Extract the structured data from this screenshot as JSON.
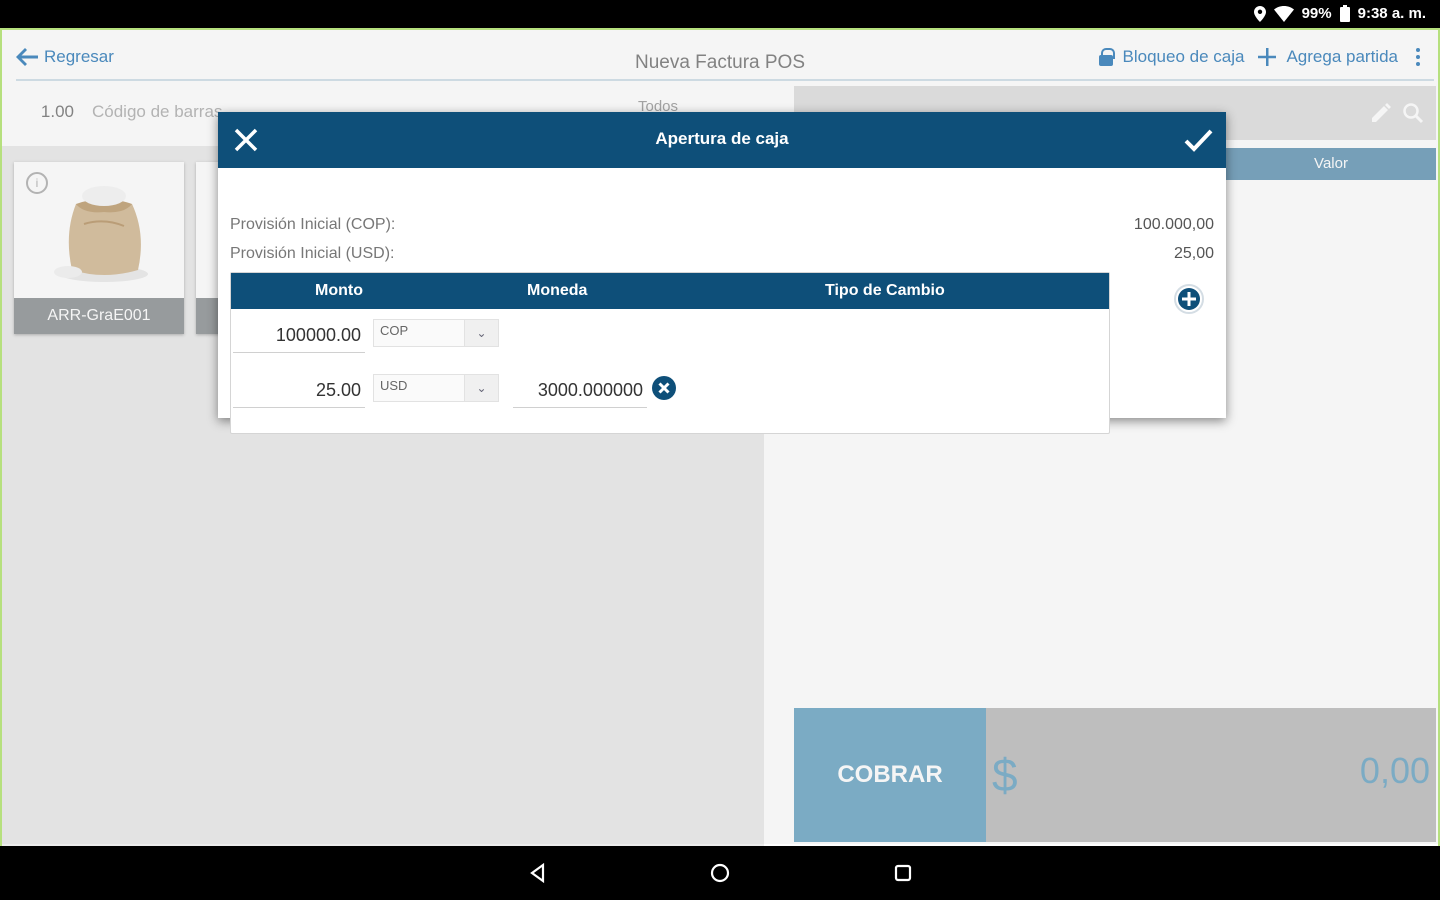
{
  "status_bar": {
    "battery": "99%",
    "time": "9:38 a. m."
  },
  "topbar": {
    "back_label": "Regresar",
    "title": "Nueva Factura POS",
    "lock_label": "Bloqueo de caja",
    "add_label": "Agrega partida"
  },
  "left": {
    "quantity": "1.00",
    "barcode_placeholder": "Código de barras",
    "filter_label": "Todos",
    "products": [
      {
        "code": "ARR-GraE001"
      }
    ]
  },
  "right": {
    "column_value": "Valor",
    "charge_label": "COBRAR",
    "currency_symbol": "$",
    "total": "0,00"
  },
  "dialog": {
    "title": "Apertura de caja",
    "provisions": [
      {
        "label": "Provisión Inicial (COP):",
        "value": "100.000,00"
      },
      {
        "label": "Provisión Inicial (USD):",
        "value": "25,00"
      }
    ],
    "headers": {
      "amount": "Monto",
      "currency": "Moneda",
      "rate": "Tipo de Cambio"
    },
    "rows": [
      {
        "amount": "100000.00",
        "currency": "COP",
        "rate": ""
      },
      {
        "amount": "25.00",
        "currency": "USD",
        "rate": "3000.000000"
      }
    ]
  },
  "colors": {
    "header_blue": "#0e4f79",
    "accent_blue": "#4e8fc4",
    "charge_blue": "#80b2cc",
    "frame_green": "#b6e07e"
  }
}
